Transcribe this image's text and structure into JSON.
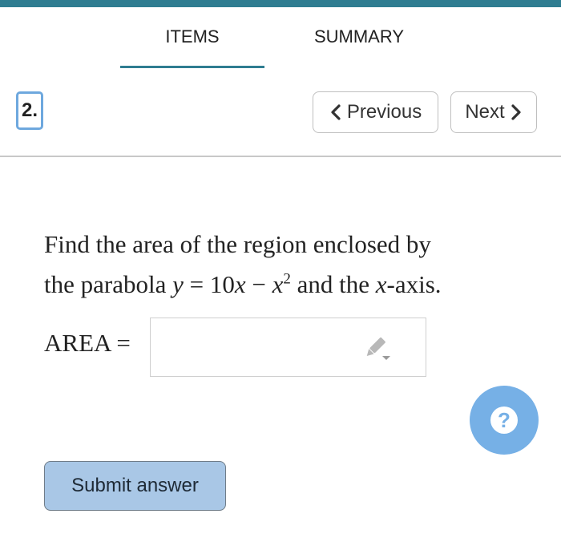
{
  "tabs": {
    "items_label": "ITEMS",
    "summary_label": "SUMMARY"
  },
  "question": {
    "number": "2.",
    "text_part1": "Find the area of the region enclosed by",
    "text_part2_prefix": "the parabola ",
    "y_var": "y",
    "equals": " = ",
    "coefficient": "10",
    "x_var": "x",
    "minus": " − ",
    "x_var2": "x",
    "exponent": "2",
    "text_part2_mid": " and the ",
    "x_var3": "x",
    "text_part2_suffix": "-axis."
  },
  "navigation": {
    "previous_label": "Previous",
    "next_label": "Next"
  },
  "answer": {
    "label": "AREA =",
    "value": ""
  },
  "submit_label": "Submit answer",
  "help_glyph": "?",
  "icons": {
    "previous": "chevron-left-icon",
    "next": "chevron-right-icon",
    "pencil": "pencil-dropdown-icon",
    "help": "question-icon"
  },
  "colors": {
    "accent": "#2f7d91",
    "help_button": "#76b0e6",
    "submit_button": "#a9c7e6",
    "question_number_border": "#6ea8de"
  }
}
